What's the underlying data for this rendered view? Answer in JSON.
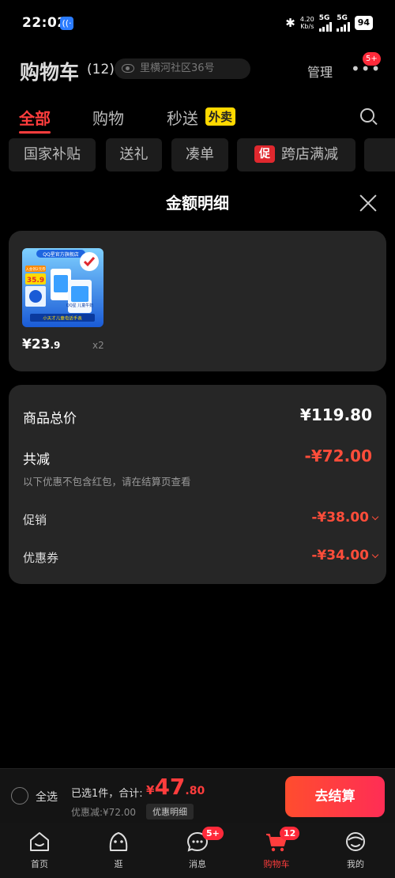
{
  "status_bar": {
    "time": "22:02",
    "net_speed": "4.20",
    "net_unit": "Kb/s",
    "sig1": "5G",
    "sig2": "5G",
    "battery": "94"
  },
  "header": {
    "title": "购物车",
    "count": "(12)",
    "address": "里横河社区36号",
    "manage_label": "管理",
    "more_badge": "5+"
  },
  "tabs": [
    {
      "label": "全部",
      "active": true
    },
    {
      "label": "购物",
      "active": false
    },
    {
      "label": "秒送",
      "active": false
    }
  ],
  "tab_tag": "外卖",
  "chips": [
    "国家补贴",
    "送礼",
    "凑单",
    "跨店满减"
  ],
  "chip_tag": "促",
  "sheet": {
    "title": "金额明细"
  },
  "product": {
    "price_int": "¥23",
    "price_dec": ".9",
    "qty": "x2",
    "image_texts": {
      "brand": "QQ星官方旗舰店",
      "badge": "入会领2元券",
      "price": "35.9",
      "product": "QQ星 儿童牛奶",
      "promo": "小天才儿童电话手表"
    }
  },
  "summary": {
    "total_label": "商品总价",
    "total_value": "¥119.80",
    "reduce_label": "共减",
    "reduce_value": "-¥72.00",
    "note": "以下优惠不包含红包，请在结算页查看",
    "promo_label": "促销",
    "promo_value": "-¥38.00",
    "coupon_label": "优惠券",
    "coupon_value": "-¥34.00"
  },
  "checkout": {
    "select_all": "全选",
    "selected_text": "已选1件，合计:",
    "amount_symbol": "¥",
    "amount_int": "47",
    "amount_dec": ".80",
    "discount_text": "优惠减:¥72.00",
    "detail_label": "优惠明细",
    "pay_label": "去结算"
  },
  "tabbar": [
    {
      "label": "首页",
      "icon": "home-icon"
    },
    {
      "label": "逛",
      "icon": "browse-icon"
    },
    {
      "label": "消息",
      "icon": "message-icon",
      "badge": "5+"
    },
    {
      "label": "购物车",
      "icon": "cart-icon",
      "badge": "12",
      "active": true
    },
    {
      "label": "我的",
      "icon": "profile-icon"
    }
  ],
  "colors": {
    "accent": "#ff3d3d",
    "price_red": "#ff4d3a",
    "badge_red": "#ff2a3a",
    "tag_yellow": "#ffd900"
  }
}
